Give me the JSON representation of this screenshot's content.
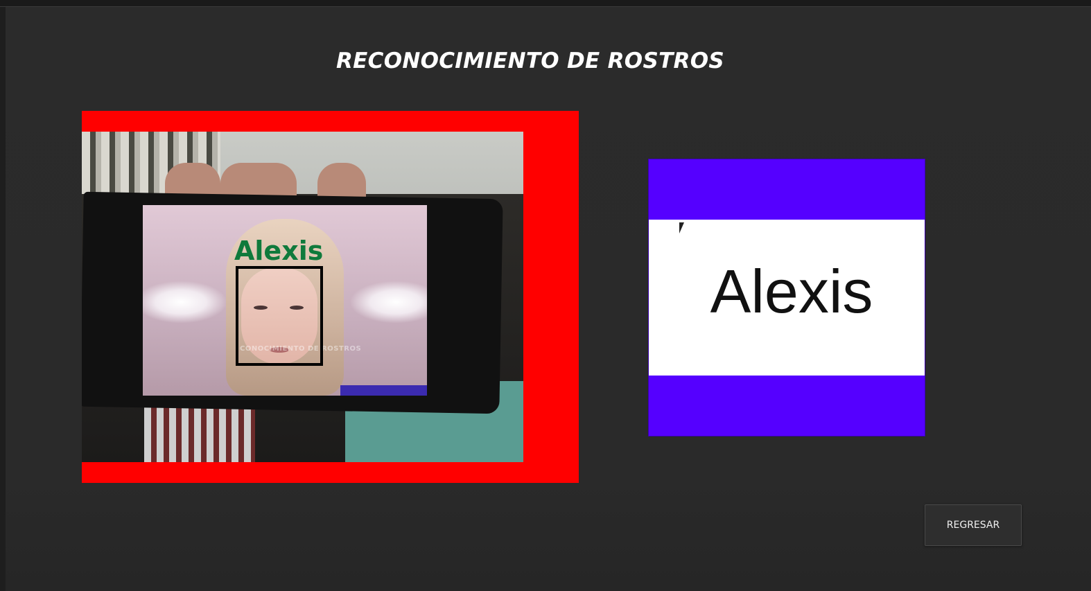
{
  "window": {
    "title": "RECONOCIMIENTO DE ROSTROS"
  },
  "camera": {
    "detected_label": "Alexis",
    "screen_caption": "CONOCIMIENTO DE ROSTROS",
    "frame_color": "#ff0000",
    "label_color": "#0f7a3c"
  },
  "result_panel": {
    "name": "Alexis",
    "band_color": "#5500ff"
  },
  "actions": {
    "back_label": "REGRESAR"
  }
}
